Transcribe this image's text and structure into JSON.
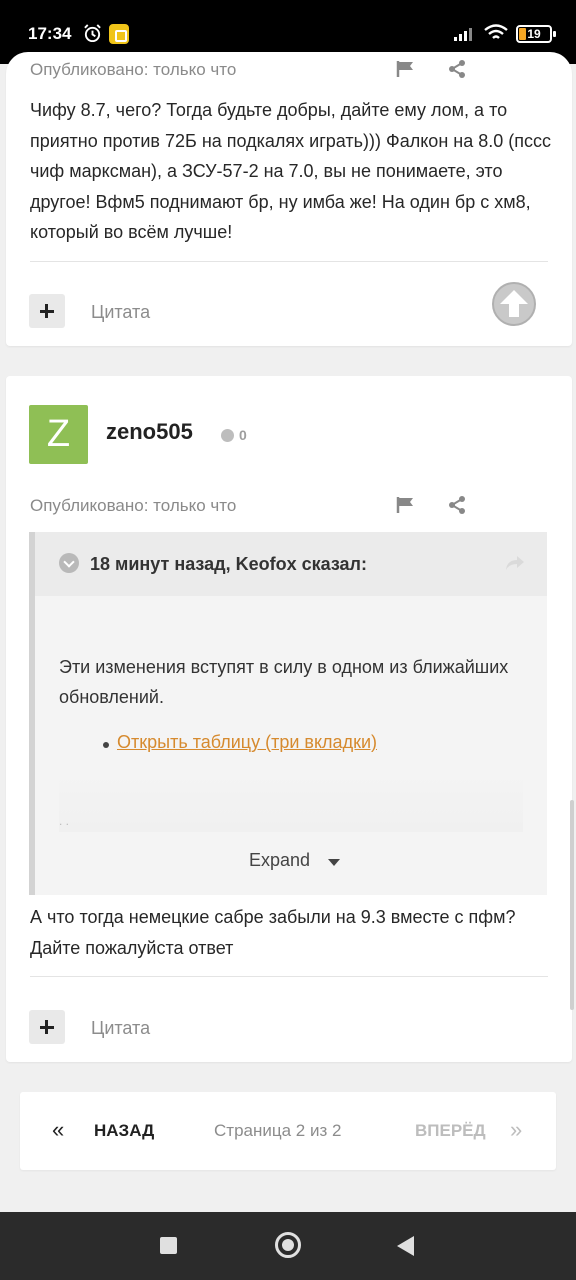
{
  "status_bar": {
    "time": "17:34",
    "battery": "19"
  },
  "post1": {
    "published": "Опубликовано: только что",
    "text": "Чифу 8.7, чего? Тогда будьте добры, дайте ему лом, а то приятно против 72Б на подкалях играть))) Фалкон на 8.0 (пссс чиф марксман), а ЗСУ-57-2 на 7.0, вы не понимаете, это другое! Вфм5 поднимают бр, ну имба же! На один бр с хм8, который во всём лучше!",
    "quote_label": "Цитата"
  },
  "post2": {
    "avatar_letter": "Z",
    "username": "zeno505",
    "reputation": "0",
    "published": "Опубликовано: только что",
    "quote": {
      "author": "18 минут назад, Keofox сказал:",
      "body": "Эти изменения вступят в силу в одном из ближайших обновлений.",
      "link": "Открыть таблицу (три вкладки)",
      "expand": "Expand"
    },
    "text": "А что тогда немецкие сабре забыли на 9.3 вместе с пфм? Дайте пожалуйста ответ",
    "quote_label": "Цитата"
  },
  "pagination": {
    "prev": "НАЗАД",
    "info": "Страница 2 из 2",
    "next": "ВПЕРЁД",
    "prev_arrow": "«",
    "next_arrow": "»"
  },
  "colors": {
    "link": "#d68a2e",
    "avatar": "#8fbf55"
  }
}
